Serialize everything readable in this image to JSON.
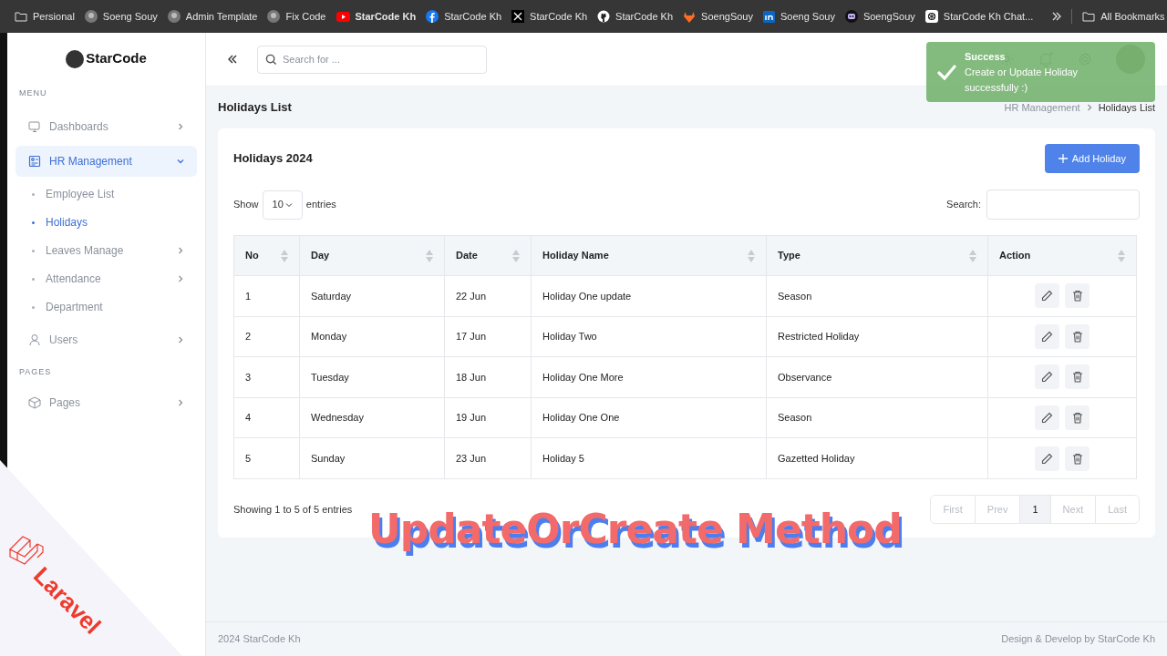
{
  "bookmarks": [
    {
      "label": "Persional",
      "kind": "folder"
    },
    {
      "label": "Soeng Souy",
      "kind": "avatar"
    },
    {
      "label": "Admin Template",
      "kind": "avatar"
    },
    {
      "label": "Fix Code",
      "kind": "avatar"
    },
    {
      "label": "StarCode Kh",
      "kind": "youtube"
    },
    {
      "label": "StarCode Kh",
      "kind": "facebook"
    },
    {
      "label": "StarCode Kh",
      "kind": "x"
    },
    {
      "label": "StarCode Kh",
      "kind": "github"
    },
    {
      "label": "SoengSouy",
      "kind": "gitlab"
    },
    {
      "label": "Soeng Souy",
      "kind": "linkedin"
    },
    {
      "label": "SoengSouy",
      "kind": "mastodon"
    },
    {
      "label": "StarCode Kh Chat...",
      "kind": "openai"
    }
  ],
  "all_bookmarks": "All Bookmarks",
  "sidebar": {
    "logo": "StarCode",
    "sections": [
      {
        "title": "MENU",
        "items": [
          {
            "label": "Dashboards",
            "kind": "monitor",
            "selected": false,
            "expandable": true,
            "expanded": false
          },
          {
            "label": "HR Management",
            "kind": "hr",
            "selected": true,
            "expandable": true,
            "expanded": true,
            "children": [
              {
                "label": "Employee List",
                "selected": false,
                "expandable": false
              },
              {
                "label": "Holidays",
                "selected": true,
                "expandable": false
              },
              {
                "label": "Leaves Manage",
                "selected": false,
                "expandable": true
              },
              {
                "label": "Attendance",
                "selected": false,
                "expandable": true
              },
              {
                "label": "Department",
                "selected": false,
                "expandable": false
              }
            ]
          },
          {
            "label": "Users",
            "kind": "user",
            "selected": false,
            "expandable": true,
            "expanded": false
          }
        ]
      },
      {
        "title": "PAGES",
        "items": [
          {
            "label": "Pages",
            "kind": "cube",
            "selected": false,
            "expandable": true,
            "expanded": false
          }
        ]
      }
    ]
  },
  "header": {
    "search": {
      "placeholder": "Search for ..."
    }
  },
  "page_title": "Holidays List",
  "breadcrumb": [
    "HR Management",
    "Holidays List"
  ],
  "card": {
    "title": "Holidays 2024",
    "add_button": "Add Holiday",
    "show_label": "Show",
    "page_size": "10",
    "entries_label": "entries",
    "search_label": "Search:"
  },
  "table": {
    "columns": [
      "No",
      "Day",
      "Date",
      "Holiday Name",
      "Type",
      "Action"
    ],
    "rows": [
      [
        "1",
        "Saturday",
        "22 Jun",
        "Holiday One update",
        "Season"
      ],
      [
        "2",
        "Monday",
        "17 Jun",
        "Holiday Two",
        "Restricted Holiday"
      ],
      [
        "3",
        "Tuesday",
        "18 Jun",
        "Holiday One More",
        "Observance"
      ],
      [
        "4",
        "Wednesday",
        "19 Jun",
        "Holiday One One",
        "Season"
      ],
      [
        "5",
        "Sunday",
        "23 Jun",
        "Holiday 5",
        "Gazetted Holiday"
      ]
    ]
  },
  "table_info": "Showing 1 to 5 of 5 entries",
  "pagination": [
    {
      "label": "First",
      "selected": false,
      "disabled": true
    },
    {
      "label": "Prev",
      "selected": false,
      "disabled": true
    },
    {
      "label": "1",
      "selected": true,
      "disabled": false
    },
    {
      "label": "Next",
      "selected": false,
      "disabled": true
    },
    {
      "label": "Last",
      "selected": false,
      "disabled": true
    }
  ],
  "toast": {
    "title": "Success",
    "message": "Create or Update Holiday successfully :)"
  },
  "footer": {
    "left": "2024 StarCode Kh",
    "right": "Design & Develop by StarCode Kh"
  },
  "overlay": {
    "title": "UpdateOrCreate Method",
    "banner": "Laravel"
  }
}
